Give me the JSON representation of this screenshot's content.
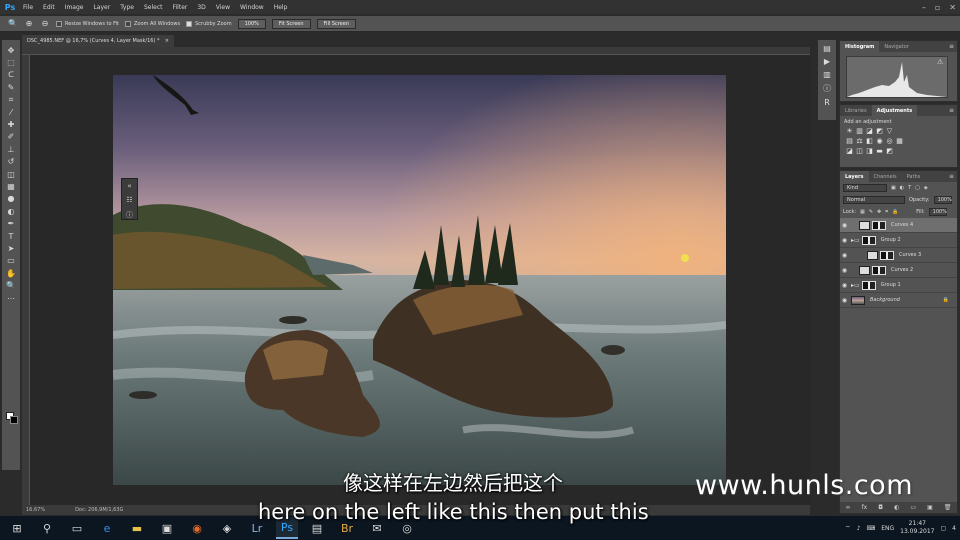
{
  "app": {
    "logo": "Ps",
    "menu": [
      "File",
      "Edit",
      "Image",
      "Layer",
      "Type",
      "Select",
      "Filter",
      "3D",
      "View",
      "Window",
      "Help"
    ],
    "window_controls": [
      "–",
      "▫",
      "✕"
    ]
  },
  "options_bar": {
    "resize_windows": "Resize Windows to Fit",
    "zoom_all": "Zoom All Windows",
    "scrubby_zoom": "Scrubby Zoom",
    "btn_100": "100%",
    "btn_fit": "Fit Screen",
    "btn_fill": "Fill Screen"
  },
  "document": {
    "tab_title": "DSC_4985.NEF @ 16,7% (Curves 4, Layer Mask/16) *",
    "tab_close": "×",
    "zoom": "16,67%",
    "doc_size": "Doc: 206,9M/1,63G"
  },
  "panels": {
    "histogram_tabs": [
      "Histogram",
      "Navigator"
    ],
    "adjust_tabs": [
      "Libraries",
      "Adjustments"
    ],
    "add_adjustment": "Add an adjustment",
    "layers_tabs": [
      "Layers",
      "Channels",
      "Paths"
    ],
    "kind": "Kind",
    "blend_mode": "Normal",
    "opacity_label": "Opacity:",
    "opacity": "100%",
    "lock_label": "Lock:",
    "fill_label": "Fill:",
    "fill": "100%",
    "layers": [
      {
        "name": "Curves 4",
        "type": "adjustment",
        "indent": 1,
        "selected": true
      },
      {
        "name": "Group 2",
        "type": "group",
        "indent": 0,
        "selected": false
      },
      {
        "name": "Curves 3",
        "type": "adjustment",
        "indent": 2,
        "selected": false
      },
      {
        "name": "Curves 2",
        "type": "adjustment",
        "indent": 1,
        "selected": false
      },
      {
        "name": "Group 1",
        "type": "group",
        "indent": 0,
        "selected": false
      },
      {
        "name": "Background",
        "type": "image",
        "indent": 0,
        "selected": false
      }
    ]
  },
  "subtitles": {
    "chinese": "像这样在左边然后把这个",
    "english": "here on the left like this then put this"
  },
  "watermark": "www.hunls.com",
  "taskbar": {
    "lang": "ENG",
    "time": "21:47",
    "date": "13.09.2017",
    "notifications": "4"
  }
}
